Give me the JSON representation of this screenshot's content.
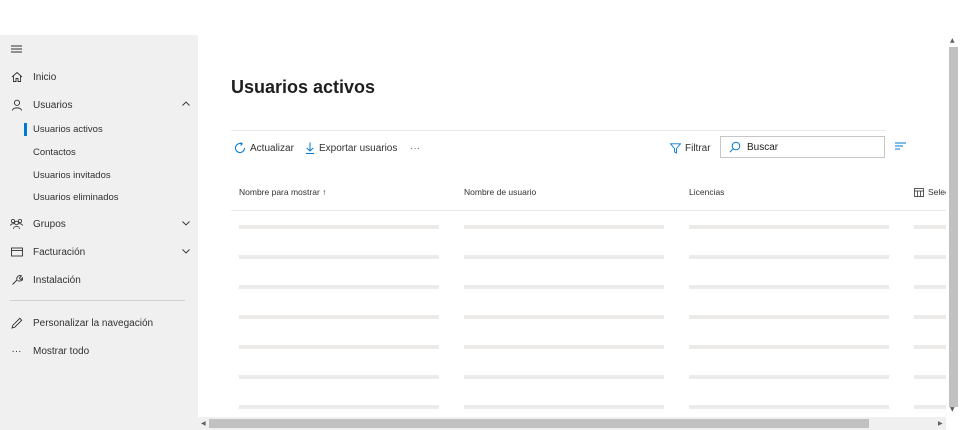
{
  "sidebar": {
    "items": [
      {
        "label": "Inicio",
        "icon": "home-icon"
      },
      {
        "label": "Usuarios",
        "icon": "person-icon",
        "expanded": true
      },
      {
        "label": "Grupos",
        "icon": "group-icon",
        "expanded": false
      },
      {
        "label": "Facturación",
        "icon": "card-icon",
        "expanded": false
      },
      {
        "label": "Instalación",
        "icon": "wrench-icon"
      }
    ],
    "sub_items": [
      "Usuarios activos",
      "Contactos",
      "Usuarios invitados",
      "Usuarios eliminados"
    ],
    "selected_sub": "Usuarios activos",
    "customize": "Personalizar la navegación",
    "show_all": "Mostrar todo"
  },
  "page": {
    "title": "Usuarios activos"
  },
  "toolbar": {
    "refresh": "Actualizar",
    "export": "Exportar usuarios",
    "more": "···",
    "filter": "Filtrar",
    "search_placeholder": "Buscar"
  },
  "table": {
    "columns": [
      "Nombre para mostrar ↑",
      "Nombre de usuario",
      "Licencias",
      "Selec"
    ]
  },
  "colors": {
    "accent": "#0078d4",
    "sidebar_bg": "#f0f0f0",
    "skeleton": "#edebe9"
  }
}
